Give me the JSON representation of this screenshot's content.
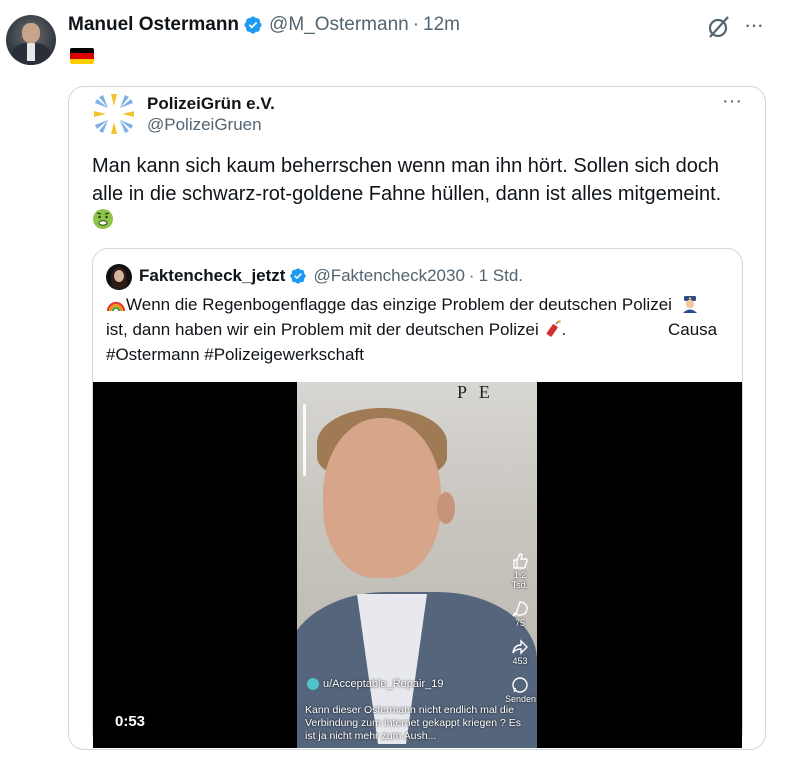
{
  "post": {
    "author_name": "Manuel Ostermann",
    "handle": "@M_Ostermann",
    "separator": "·",
    "time": "12m",
    "more_label": "···",
    "flag_emoji": "germany-flag"
  },
  "quoted": {
    "author_name": "PolizeiGrün e.V.",
    "handle": "@PolizeiGruen",
    "more_label": "···",
    "text": "Man kann sich kaum beherrschen wenn man ihn hört. Sollen sich doch alle in die schwarz-rot-goldene Fahne hüllen, dann ist alles mitgemeint.",
    "emoji": "nauseated-face"
  },
  "nested": {
    "author_name": "Faktencheck_jetzt",
    "handle": "@Faktencheck2030",
    "separator": "·",
    "time": "1 Std.",
    "line1": "Wenn die Regenbogenflagge das einzige Problem der deutschen Polizei",
    "line2": "ist, dann haben wir ein Problem mit der deutschen Polizei",
    "line2_end": ".",
    "causa": "Causa",
    "line3": "#Ostermann #Polizeigewerkschaft"
  },
  "video": {
    "duration": "0:53",
    "logo_text": "P E",
    "reddit_user": "u/Acceptable_Repair_19",
    "caption": "Kann dieser Ostermann nicht endlich mal die Verbindung zum Internet gekappt kriegen ? Es ist ja nicht mehr zum Aush...",
    "likes": "1,2 Tsd.",
    "comments": "75",
    "shares": "453",
    "send_label": "Senden"
  },
  "colors": {
    "text_primary": "#0f1419",
    "text_secondary": "#536471",
    "border": "#cfd9de",
    "verified_blue": "#1d9bf0"
  }
}
